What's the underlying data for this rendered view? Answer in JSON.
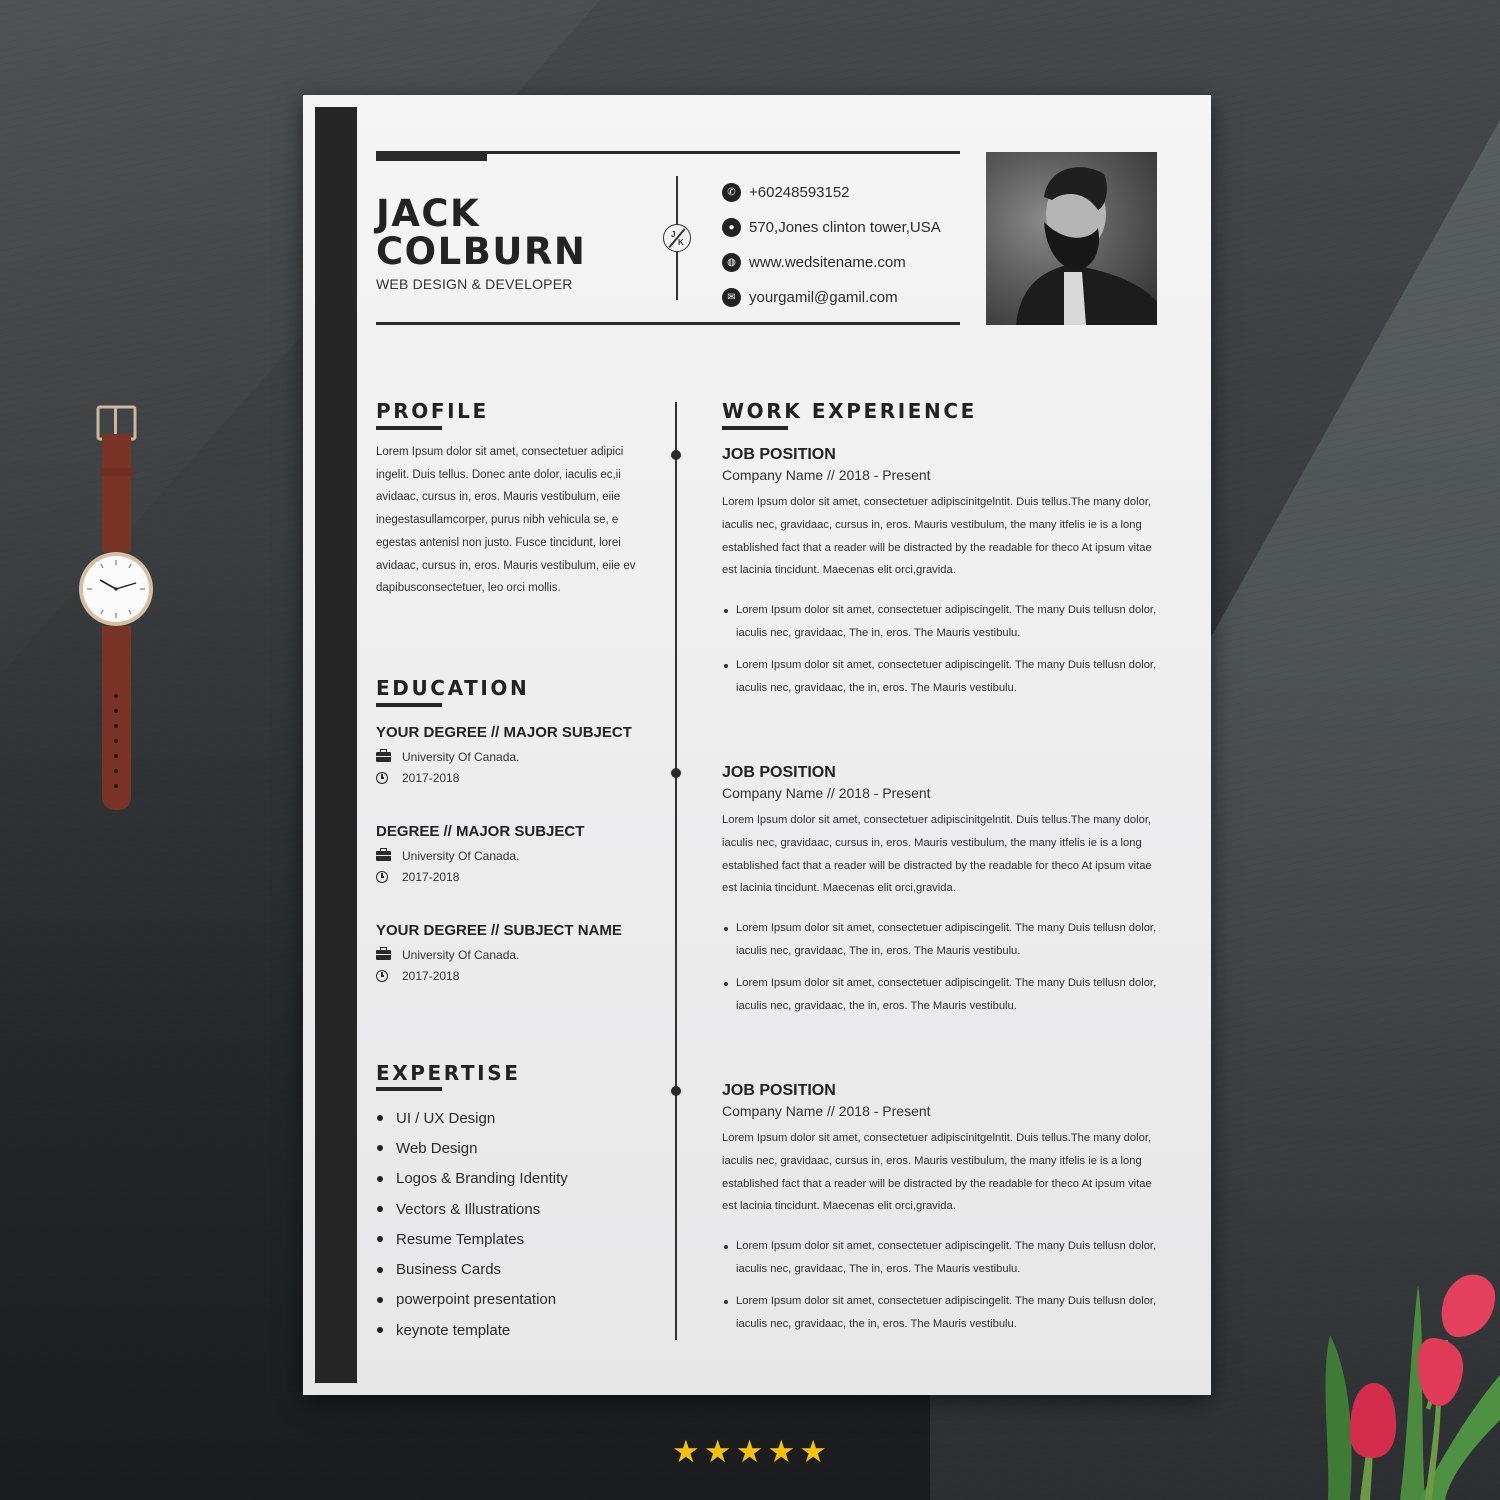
{
  "resume": {
    "name_first": "JACK",
    "name_last": "COLBURN",
    "job_title": "WEB DESIGN & DEVELOPER",
    "monogram": {
      "first": "J",
      "second": "K"
    },
    "contacts": [
      {
        "icon": "phone-icon",
        "glyph": "✆",
        "text": "+60248593152"
      },
      {
        "icon": "location-pin-icon",
        "glyph": "●",
        "text": "570,Jones clinton tower,USA"
      },
      {
        "icon": "globe-icon",
        "glyph": "◍",
        "text": "www.wedsitename.com"
      },
      {
        "icon": "envelope-icon",
        "glyph": "✉",
        "text": "yourgamil@gamil.com"
      }
    ],
    "photo_alt": "Black and white portrait of bearded man in leather jacket"
  },
  "profile": {
    "heading": "PROFILE",
    "text": "Lorem Ipsum dolor sit amet, consectetuer adipici ingelit. Duis tellus. Donec ante dolor, iaculis ec,ii avidaac, cursus in, eros. Mauris vestibulum, eiie inegestasullamcorper, purus nibh vehicula se, e egestas antenisl non justo. Fusce tincidunt, lorei avidaac, cursus in, eros. Mauris vestibulum, eiie ev dapibusconsectetuer, leo orci mollis."
  },
  "education": {
    "heading": "EDUCATION",
    "items": [
      {
        "degree": "YOUR DEGREE //  MAJOR SUBJECT",
        "school": "University Of Canada.",
        "years": "2017-2018"
      },
      {
        "degree": "DEGREE //  MAJOR SUBJECT",
        "school": "University Of Canada.",
        "years": "2017-2018"
      },
      {
        "degree": "YOUR DEGREE // SUBJECT NAME",
        "school": "University Of Canada.",
        "years": "2017-2018"
      }
    ]
  },
  "expertise": {
    "heading": "EXPERTISE",
    "items": [
      "UI / UX Design",
      "Web Design",
      "Logos & Branding Identity",
      "Vectors & Illustrations",
      "Resume Templates",
      "Business Cards",
      "powerpoint presentation",
      "keynote template"
    ]
  },
  "work": {
    "heading": "WORK EXPERIENCE",
    "jobs": [
      {
        "title": "JOB POSITION",
        "company_dates": "Company Name  //  2018 - Present",
        "description": "Lorem Ipsum dolor sit amet, consectetuer adipiscinitgelntit. Duis tellus.The many dolor, iaculis nec, gravidaac, cursus in, eros. Mauris vestibulum, the many itfelis ie is a long established fact that a reader will be distracted by the readable for theco At ipsum vitae est lacinia tincidunt. Maecenas elit orci,gravida.",
        "bullets": [
          "Lorem Ipsum dolor sit amet, consectetuer adipiscingelit. The many Duis tellusn dolor, iaculis nec, gravidaac, The in, eros. The Mauris vestibulu.",
          "Lorem Ipsum dolor sit amet, consectetuer adipiscingelit. The many Duis tellusn dolor, iaculis nec, gravidaac, the in, eros. The Mauris vestibulu."
        ]
      },
      {
        "title": "JOB POSITION",
        "company_dates": "Company Name  //  2018 - Present",
        "description": "Lorem Ipsum dolor sit amet, consectetuer adipiscinitgelntit. Duis tellus.The many dolor, iaculis nec, gravidaac, cursus in, eros. Mauris vestibulum, the many itfelis ie is a long established fact that a reader will be distracted by the readable for theco At ipsum vitae est lacinia tincidunt. Maecenas elit orci,gravida.",
        "bullets": [
          "Lorem Ipsum dolor sit amet, consectetuer adipiscingelit. The many Duis tellusn dolor, iaculis nec, gravidaac, The in, eros. The Mauris vestibulu.",
          "Lorem Ipsum dolor sit amet, consectetuer adipiscingelit. The many Duis tellusn dolor, iaculis nec, gravidaac, the in, eros. The Mauris vestibulu."
        ]
      },
      {
        "title": "JOB POSITION",
        "company_dates": "Company Name  //  2018 - Present",
        "description": "Lorem Ipsum dolor sit amet, consectetuer adipiscinitgelntit. Duis tellus.The many dolor, iaculis nec, gravidaac, cursus in, eros. Mauris vestibulum, the many itfelis ie is a long established fact that a reader will be distracted by the readable for theco At ipsum vitae est lacinia tincidunt. Maecenas elit orci,gravida.",
        "bullets": [
          "Lorem Ipsum dolor sit amet, consectetuer adipiscingelit. The many Duis tellusn dolor, iaculis nec, gravidaac, The in, eros. The Mauris vestibulu.",
          "Lorem Ipsum dolor sit amet, consectetuer adipiscingelit. The many Duis tellusn dolor, iaculis nec, gravidaac, the in, eros. The Mauris vestibulu."
        ]
      }
    ]
  },
  "rating": {
    "stars": 5,
    "max": 5,
    "glyph": "★"
  },
  "colors": {
    "ink": "#232323",
    "sidebar": "#262626",
    "paper": "#f0f0f0",
    "star": "#f4c20d",
    "background": "#3b3e40"
  }
}
